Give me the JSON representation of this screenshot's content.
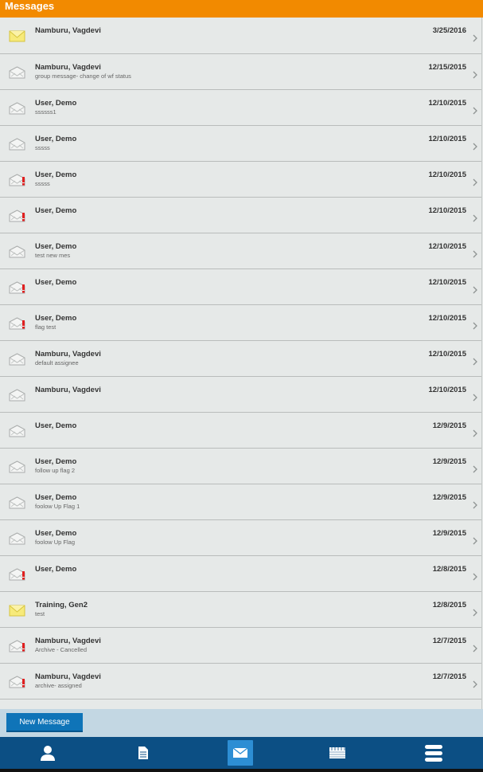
{
  "header": {
    "title": "Messages"
  },
  "colors": {
    "header": "#f28a00",
    "tabbar": "#0c4f84",
    "button": "#0f74b8",
    "flag": "#e02020"
  },
  "messages": [
    {
      "sender": "Namburu, Vagdevi",
      "subject": "",
      "date": "3/25/2016",
      "icon": "unread-envelope-icon"
    },
    {
      "sender": "Namburu, Vagdevi",
      "subject": "group message- change of wf status",
      "date": "12/15/2015",
      "icon": "read-envelope-icon"
    },
    {
      "sender": "User, Demo",
      "subject": "ssssss1",
      "date": "12/10/2015",
      "icon": "read-envelope-icon"
    },
    {
      "sender": "User, Demo",
      "subject": "sssss",
      "date": "12/10/2015",
      "icon": "read-envelope-icon"
    },
    {
      "sender": "User, Demo",
      "subject": "sssss",
      "date": "12/10/2015",
      "icon": "flagged-envelope-icon"
    },
    {
      "sender": "User, Demo",
      "subject": "",
      "date": "12/10/2015",
      "icon": "flagged-envelope-icon"
    },
    {
      "sender": "User, Demo",
      "subject": "test new mes",
      "date": "12/10/2015",
      "icon": "read-envelope-icon"
    },
    {
      "sender": "User, Demo",
      "subject": "",
      "date": "12/10/2015",
      "icon": "flagged-envelope-icon"
    },
    {
      "sender": "User, Demo",
      "subject": "flag test",
      "date": "12/10/2015",
      "icon": "flagged-envelope-icon"
    },
    {
      "sender": "Namburu, Vagdevi",
      "subject": "default assignee",
      "date": "12/10/2015",
      "icon": "read-envelope-icon"
    },
    {
      "sender": "Namburu, Vagdevi",
      "subject": "",
      "date": "12/10/2015",
      "icon": "read-envelope-icon"
    },
    {
      "sender": "User, Demo",
      "subject": "",
      "date": "12/9/2015",
      "icon": "read-envelope-icon"
    },
    {
      "sender": "User, Demo",
      "subject": "follow up flag 2",
      "date": "12/9/2015",
      "icon": "read-envelope-icon"
    },
    {
      "sender": "User, Demo",
      "subject": "foolow Up Flag 1",
      "date": "12/9/2015",
      "icon": "read-envelope-icon"
    },
    {
      "sender": "User, Demo",
      "subject": "foolow Up Flag",
      "date": "12/9/2015",
      "icon": "read-envelope-icon"
    },
    {
      "sender": "User, Demo",
      "subject": "",
      "date": "12/8/2015",
      "icon": "flagged-envelope-icon"
    },
    {
      "sender": "Training, Gen2",
      "subject": "test",
      "date": "12/8/2015",
      "icon": "unread-envelope-icon"
    },
    {
      "sender": "Namburu, Vagdevi",
      "subject": "Archive - Cancelled",
      "date": "12/7/2015",
      "icon": "flagged-envelope-icon"
    },
    {
      "sender": "Namburu, Vagdevi",
      "subject": "archive- assigned",
      "date": "12/7/2015",
      "icon": "flagged-envelope-icon"
    }
  ],
  "actions": {
    "new_message_label": "New Message"
  },
  "tabs": [
    {
      "icon": "person-icon",
      "active": false
    },
    {
      "icon": "document-icon",
      "active": false
    },
    {
      "icon": "mail-icon",
      "active": true
    },
    {
      "icon": "calendar-icon",
      "active": false
    },
    {
      "icon": "menu-icon",
      "active": false
    }
  ]
}
